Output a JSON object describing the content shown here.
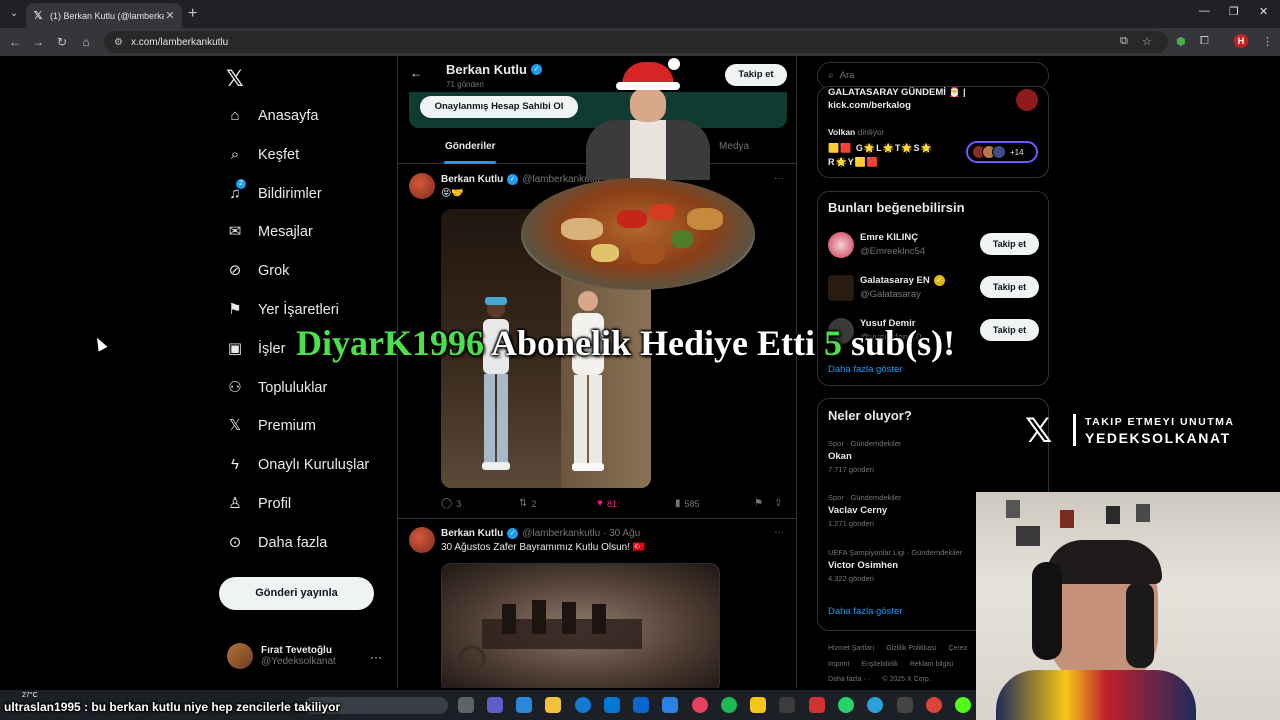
{
  "browser": {
    "tab_title": "(1) Berkan Kutlu (@lamberkanku",
    "url": "x.com/lamberkankutlu",
    "profile_initial": "H"
  },
  "sidebar": {
    "items": [
      {
        "label": "Anasayfa",
        "icon": "home-icon"
      },
      {
        "label": "Keşfet",
        "icon": "search-icon"
      },
      {
        "label": "Bildirimler",
        "icon": "bell-icon",
        "badge": "2"
      },
      {
        "label": "Mesajlar",
        "icon": "mail-icon"
      },
      {
        "label": "Grok",
        "icon": "grok-icon"
      },
      {
        "label": "Yer İşaretleri",
        "icon": "bookmark-icon"
      },
      {
        "label": "İşler",
        "icon": "briefcase-icon"
      },
      {
        "label": "Topluluklar",
        "icon": "people-icon"
      },
      {
        "label": "Premium",
        "icon": "x-icon"
      },
      {
        "label": "Onaylı Kuruluşlar",
        "icon": "lightning-icon"
      },
      {
        "label": "Profil",
        "icon": "person-icon"
      },
      {
        "label": "Daha fazla",
        "icon": "more-circle-icon"
      }
    ],
    "post_button": "Gönderi yayınla",
    "account": {
      "name": "Fırat Tevetoğlu",
      "handle": "@Yedeksolkanat"
    }
  },
  "profile": {
    "name": "Berkan Kutlu",
    "post_count": "71 gönderi",
    "follow_label": "Takip et",
    "banner_button": "Onaylanmış Hesap Sahibi Ol",
    "tabs": [
      "Gönderiler",
      "Medya"
    ]
  },
  "tweets": [
    {
      "name": "Berkan Kutlu",
      "handle": "@lamberkankutlu",
      "text": "😝🤝",
      "replies": "3",
      "retweets": "2",
      "likes": "81",
      "views": "585"
    },
    {
      "name": "Berkan Kutlu",
      "handle": "@lamberkankutlu · 30 Ağu",
      "text": "30 Ağustos Zafer Bayramımız Kutlu Olsun! 🇹🇷"
    }
  ],
  "right": {
    "search_placeholder": "Ara",
    "space": {
      "title_line1": "GALATASARAY GÜNDEMİ 🎅 |",
      "title_line2": "kick.com/berkalog",
      "listener_name": "Volkan",
      "listener_suffix": "dinliyor",
      "emoji_line1": "🟨🟥 G🌟L🌟T🌟S🌟",
      "emoji_line2": "R🌟Y🟨🟥",
      "extra_count": "+14"
    },
    "suggestions_title": "Bunları beğenebilirsin",
    "suggestions": [
      {
        "name": "Emre KILINÇ",
        "handle": "@Emreeklnc54",
        "follow": "Takip et"
      },
      {
        "name": "Galatasaray EN",
        "handle": "@Galatasaray",
        "follow": "Takip et"
      },
      {
        "name": "Yusuf Demir",
        "handle": "@yusufdem10",
        "follow": "Takip et"
      }
    ],
    "show_more": "Daha fazla göster",
    "trends_title": "Neler oluyor?",
    "trends": [
      {
        "category": "Spor · Gündemdekiler",
        "name": "Okan",
        "posts": "7.717 gönderi"
      },
      {
        "category": "Spor · Gündemdekiler",
        "name": "Vaclav Cerny",
        "posts": "1.271 gönderi"
      },
      {
        "category": "UEFA Şampiyonlar Ligi · Gündemdekiler",
        "name": "Victor Osimhen",
        "posts": "4.322 gönderi"
      }
    ],
    "trends_more": "Daha fazla göster",
    "footer_line1": [
      "Hizmet Şartları",
      "Gizlilik Politikası",
      "Çerez"
    ],
    "footer_line2": [
      "Imprint",
      "Erişilebilirlik",
      "Reklam bilgisi"
    ],
    "footer_line3": [
      "Daha fazla ···",
      "© 2025 X Corp."
    ]
  },
  "overlay": {
    "gift_user": "DiyarK1996",
    "gift_mid": "Abonelik Hediye Etti",
    "gift_count": "5",
    "gift_end": "sub(s)!",
    "brand_line1": "TAKIP ETMEYI UNUTMA",
    "brand_line2": "YEDEKSOLKANAT",
    "chat": "ultraslan1995 : bu berkan kutlu niye hep zencilerle takiliyor",
    "weather": "27°C"
  }
}
